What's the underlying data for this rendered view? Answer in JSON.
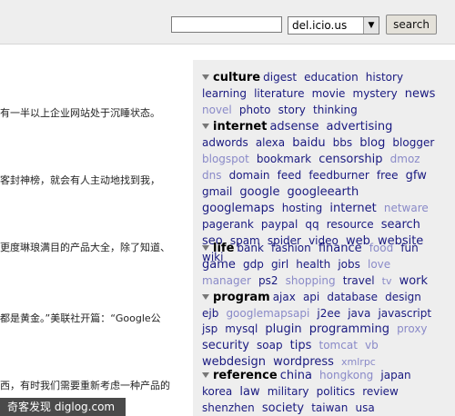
{
  "search": {
    "placeholder": "",
    "value": "",
    "button_label": "search",
    "select_value": "del.icio.us"
  },
  "article": {
    "lines": [
      "有一半以上企业网站处于沉睡状态。",
      "客封神榜，就会有人主动地找到我，",
      "更度琳琅满目的产品大全，除了知道、",
      "都是黄金。”美联社开篇：“Google公",
      "西，有时我们需要重新考虑一种产品的"
    ]
  },
  "watermark": "奇客发现 diglog.com",
  "categories": [
    {
      "name": "culture",
      "tags": [
        {
          "t": "digest",
          "s": 2
        },
        {
          "t": "education",
          "s": 2
        },
        {
          "t": "history",
          "s": 2
        },
        {
          "t": "learning",
          "s": 2
        },
        {
          "t": "literature",
          "s": 2
        },
        {
          "t": "movie",
          "s": 2
        },
        {
          "t": "mystery",
          "s": 2
        },
        {
          "t": "news",
          "s": 3
        },
        {
          "t": "novel",
          "s": 2,
          "f": true
        },
        {
          "t": "photo",
          "s": 2
        },
        {
          "t": "story",
          "s": 2
        },
        {
          "t": "thinking",
          "s": 2
        }
      ]
    },
    {
      "name": "internet",
      "tags": [
        {
          "t": "adsense",
          "s": 3
        },
        {
          "t": "advertising",
          "s": 3
        },
        {
          "t": "adwords",
          "s": 2
        },
        {
          "t": "alexa",
          "s": 2
        },
        {
          "t": "baidu",
          "s": 3
        },
        {
          "t": "bbs",
          "s": 2
        },
        {
          "t": "blog",
          "s": 3
        },
        {
          "t": "blogger",
          "s": 2
        },
        {
          "t": "blogspot",
          "s": 2,
          "f": true
        },
        {
          "t": "bookmark",
          "s": 2
        },
        {
          "t": "censorship",
          "s": 3
        },
        {
          "t": "dmoz",
          "s": 2,
          "f": true
        },
        {
          "t": "dns",
          "s": 2,
          "f": true
        },
        {
          "t": "domain",
          "s": 2
        },
        {
          "t": "feed",
          "s": 2
        },
        {
          "t": "feedburner",
          "s": 2
        },
        {
          "t": "free",
          "s": 2
        },
        {
          "t": "gfw",
          "s": 3
        },
        {
          "t": "gmail",
          "s": 2
        },
        {
          "t": "google",
          "s": 3
        },
        {
          "t": "googleearth",
          "s": 3
        },
        {
          "t": "googlemaps",
          "s": 3
        },
        {
          "t": "hosting",
          "s": 2
        },
        {
          "t": "internet",
          "s": 3
        },
        {
          "t": "netware",
          "s": 2,
          "f": true
        },
        {
          "t": "pagerank",
          "s": 2
        },
        {
          "t": "paypal",
          "s": 2
        },
        {
          "t": "qq",
          "s": 2
        },
        {
          "t": "resource",
          "s": 2
        },
        {
          "t": "search",
          "s": 3
        },
        {
          "t": "seo",
          "s": 3
        },
        {
          "t": "spam",
          "s": 2
        },
        {
          "t": "spider",
          "s": 2
        },
        {
          "t": "video",
          "s": 2
        },
        {
          "t": "web",
          "s": 3
        },
        {
          "t": "website",
          "s": 3
        },
        {
          "t": "wiki",
          "s": 2
        }
      ]
    },
    {
      "name": "life",
      "tags": [
        {
          "t": "bank",
          "s": 2
        },
        {
          "t": "fashion",
          "s": 2
        },
        {
          "t": "finance",
          "s": 3
        },
        {
          "t": "food",
          "s": 2,
          "f": true
        },
        {
          "t": "fun",
          "s": 2
        },
        {
          "t": "game",
          "s": 3
        },
        {
          "t": "gdp",
          "s": 2
        },
        {
          "t": "girl",
          "s": 2
        },
        {
          "t": "health",
          "s": 2
        },
        {
          "t": "jobs",
          "s": 2
        },
        {
          "t": "love",
          "s": 2,
          "f": true
        },
        {
          "t": "manager",
          "s": 2,
          "f": true
        },
        {
          "t": "ps2",
          "s": 2
        },
        {
          "t": "shopping",
          "s": 2,
          "f": true
        },
        {
          "t": "travel",
          "s": 2
        },
        {
          "t": "tv",
          "s": 1,
          "f": true
        },
        {
          "t": "work",
          "s": 3
        }
      ]
    },
    {
      "name": "program",
      "tags": [
        {
          "t": "ajax",
          "s": 2
        },
        {
          "t": "api",
          "s": 2
        },
        {
          "t": "database",
          "s": 2
        },
        {
          "t": "design",
          "s": 2
        },
        {
          "t": "ejb",
          "s": 2
        },
        {
          "t": "googlemapsapi",
          "s": 2,
          "f": true
        },
        {
          "t": "j2ee",
          "s": 2
        },
        {
          "t": "java",
          "s": 2
        },
        {
          "t": "javascript",
          "s": 2
        },
        {
          "t": "jsp",
          "s": 2
        },
        {
          "t": "mysql",
          "s": 2
        },
        {
          "t": "plugin",
          "s": 3
        },
        {
          "t": "programming",
          "s": 3
        },
        {
          "t": "proxy",
          "s": 2,
          "f": true
        },
        {
          "t": "security",
          "s": 3
        },
        {
          "t": "soap",
          "s": 2
        },
        {
          "t": "tips",
          "s": 3
        },
        {
          "t": "tomcat",
          "s": 2,
          "f": true
        },
        {
          "t": "vb",
          "s": 2,
          "f": true
        },
        {
          "t": "webdesign",
          "s": 3
        },
        {
          "t": "wordpress",
          "s": 3
        },
        {
          "t": "xmlrpc",
          "s": 1,
          "f": true
        }
      ]
    },
    {
      "name": "reference",
      "tags": [
        {
          "t": "china",
          "s": 3
        },
        {
          "t": "hongkong",
          "s": 2,
          "f": true
        },
        {
          "t": "japan",
          "s": 2
        },
        {
          "t": "korea",
          "s": 2
        },
        {
          "t": "law",
          "s": 3
        },
        {
          "t": "military",
          "s": 2
        },
        {
          "t": "politics",
          "s": 2
        },
        {
          "t": "review",
          "s": 2
        },
        {
          "t": "shenzhen",
          "s": 2
        },
        {
          "t": "society",
          "s": 3
        },
        {
          "t": "taiwan",
          "s": 2
        },
        {
          "t": "usa",
          "s": 2
        }
      ]
    }
  ]
}
